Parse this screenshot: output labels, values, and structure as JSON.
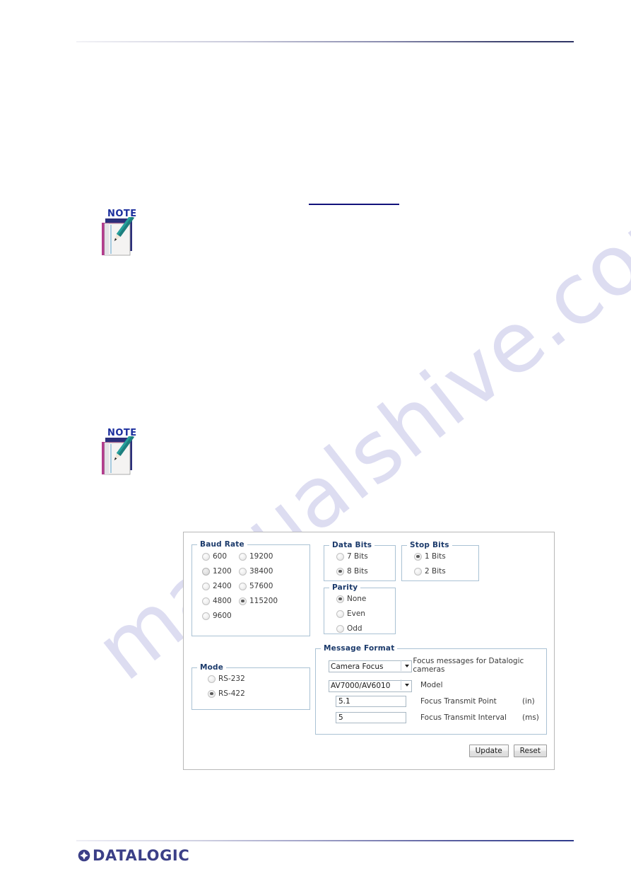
{
  "page": {
    "watermark_text": "manualshive.com",
    "note_label": "NOTE"
  },
  "brand": {
    "logo_text": "DATALOGIC",
    "logo_color": "#3b3f87"
  },
  "panel": {
    "baud_rate": {
      "legend": "Baud Rate",
      "column_left": [
        {
          "label": "600",
          "selected": false
        },
        {
          "label": "1200",
          "selected": false,
          "hover": true
        },
        {
          "label": "2400",
          "selected": false
        },
        {
          "label": "4800",
          "selected": false
        },
        {
          "label": "9600",
          "selected": false
        }
      ],
      "column_right": [
        {
          "label": "19200",
          "selected": false
        },
        {
          "label": "38400",
          "selected": false
        },
        {
          "label": "57600",
          "selected": false
        },
        {
          "label": "115200",
          "selected": true
        }
      ]
    },
    "data_bits": {
      "legend": "Data Bits",
      "options": [
        {
          "label": "7 Bits",
          "selected": false
        },
        {
          "label": "8 Bits",
          "selected": true
        }
      ]
    },
    "stop_bits": {
      "legend": "Stop Bits",
      "options": [
        {
          "label": "1 Bits",
          "selected": true
        },
        {
          "label": "2 Bits",
          "selected": false
        }
      ]
    },
    "parity": {
      "legend": "Parity",
      "options": [
        {
          "label": "None",
          "selected": true
        },
        {
          "label": "Even",
          "selected": false
        },
        {
          "label": "Odd",
          "selected": false
        }
      ]
    },
    "mode": {
      "legend": "Mode",
      "options": [
        {
          "label": "RS-232",
          "selected": false
        },
        {
          "label": "RS-422",
          "selected": true
        }
      ]
    },
    "message_format": {
      "legend": "Message Format",
      "format_select": {
        "value": "Camera Focus",
        "options": [
          "Camera Focus"
        ],
        "description": "Focus messages for Datalogic cameras"
      },
      "model_select": {
        "value": "AV7000/AV6010",
        "options": [
          "AV7000/AV6010"
        ],
        "description": "Model"
      },
      "focus_transmit_point": {
        "value": "5.1",
        "label": "Focus Transmit Point",
        "unit": "(in)"
      },
      "focus_transmit_interval": {
        "value": "5",
        "label": "Focus Transmit Interval",
        "unit": "(ms)"
      }
    },
    "buttons": {
      "update": "Update",
      "reset": "Reset"
    }
  },
  "colors": {
    "legend_blue": "#1b3a6b",
    "fieldset_border": "#aac2d4",
    "panel_border": "#b8b8b8",
    "link_rule": "#12127a",
    "watermark": "#c9c9ea"
  }
}
